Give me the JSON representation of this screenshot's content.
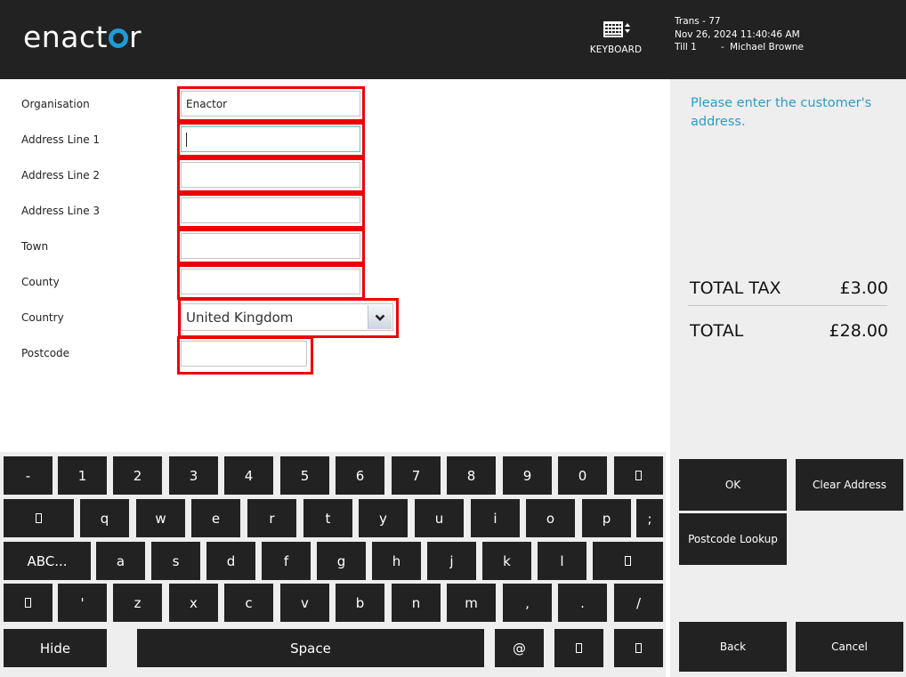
{
  "header": {
    "logo_text_left": "enact",
    "logo_text_right": "r",
    "keyboard_label": "KEYBOARD",
    "transaction": "Trans - 77",
    "datetime": "Nov 26, 2024 11:40:46 AM",
    "till": "Till 1",
    "separator": "-",
    "operator": "Michael Browne"
  },
  "form": {
    "fields": [
      {
        "label": "Organisation",
        "value": "Enactor"
      },
      {
        "label": "Address Line 1",
        "value": ""
      },
      {
        "label": "Address Line 2",
        "value": ""
      },
      {
        "label": "Address Line 3",
        "value": ""
      },
      {
        "label": "Town",
        "value": ""
      },
      {
        "label": "County",
        "value": ""
      },
      {
        "label": "Country",
        "value": "United Kingdom"
      },
      {
        "label": "Postcode",
        "value": ""
      }
    ],
    "highlight_color": "#ee0000",
    "focus_color": "#5bc8c8"
  },
  "panel": {
    "prompt": "Please enter the customer's address.",
    "total_tax_label": "TOTAL TAX",
    "total_tax_value": "£3.00",
    "total_label": "TOTAL",
    "total_value": "£28.00",
    "prompt_color": "#2a9bc9"
  },
  "actions": {
    "ok": "OK",
    "clear_address": "Clear Address",
    "postcode_lookup": "Postcode Lookup",
    "back": "Back",
    "cancel": "Cancel"
  },
  "keyboard": {
    "row1": [
      "-",
      "1",
      "2",
      "3",
      "4",
      "5",
      "6",
      "7",
      "8",
      "9",
      "0"
    ],
    "row1_backspace": "backspace-icon",
    "row2_tab": "tab-icon",
    "row2": [
      "q",
      "w",
      "e",
      "r",
      "t",
      "y",
      "u",
      "i",
      "o",
      "p",
      ";"
    ],
    "row3_mode": "ABC...",
    "row3": [
      "a",
      "s",
      "d",
      "f",
      "g",
      "h",
      "j",
      "k",
      "l"
    ],
    "row3_enter": "enter-icon",
    "row4_shift": "shift-icon",
    "row4": [
      "'",
      "z",
      "x",
      "c",
      "v",
      "b",
      "n",
      "m",
      ",",
      ".",
      "/"
    ],
    "hide": "Hide",
    "space": "Space",
    "at": "@",
    "left_arrow": "left-arrow-icon",
    "right_arrow": "right-arrow-icon"
  }
}
